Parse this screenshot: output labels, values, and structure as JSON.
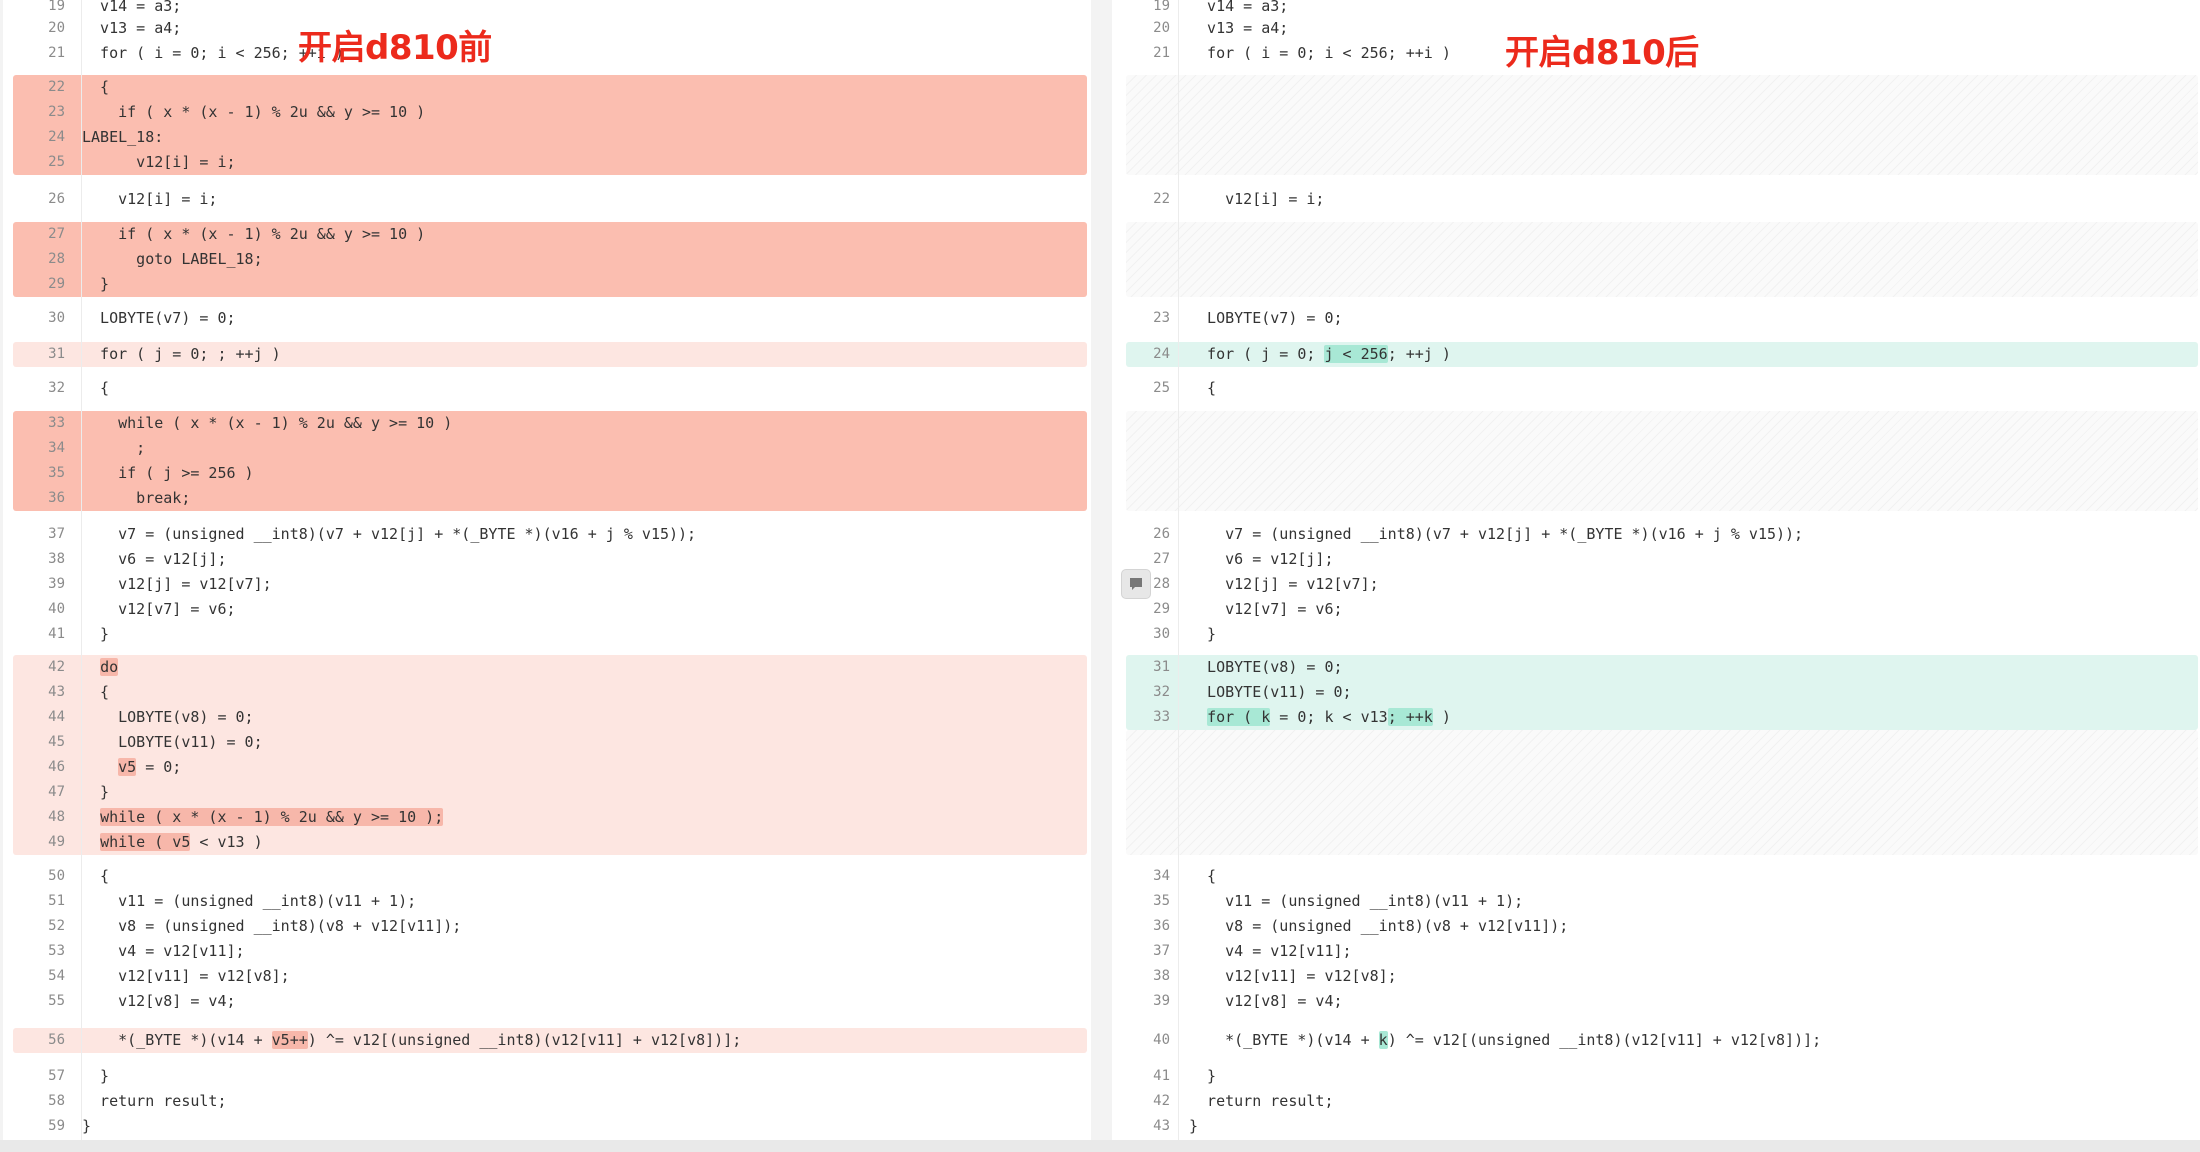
{
  "left_title": "开启d810前",
  "right_title": "开启d810后",
  "left": {
    "blocks": [
      {
        "kind": "del-strong",
        "from": 3,
        "to": 6
      },
      {
        "kind": "del-strong",
        "from": 8,
        "to": 10
      },
      {
        "kind": "del-light",
        "from": 13,
        "to": 13
      },
      {
        "kind": "del-strong",
        "from": 16,
        "to": 19
      },
      {
        "kind": "del-light",
        "from": 26,
        "to": 33
      },
      {
        "kind": "del-light",
        "from": 41,
        "to": 41
      }
    ],
    "lines": [
      {
        "row": 0,
        "n": "19",
        "t": "  v14 = a3;"
      },
      {
        "row": 1,
        "n": "20",
        "t": "  v13 = a4;"
      },
      {
        "row": 2,
        "n": "21",
        "t": "  for ( i = 0; i < 256; ++i )"
      },
      {
        "row": 3,
        "n": "22",
        "t": "  {"
      },
      {
        "row": 4,
        "n": "23",
        "t": "    if ( x * (x - 1) % 2u && y >= 10 )"
      },
      {
        "row": 5,
        "n": "24",
        "t": "LABEL_18:"
      },
      {
        "row": 6,
        "n": "25",
        "t": "      v12[i] = i;"
      },
      {
        "row": 7,
        "n": "26",
        "t": "    v12[i] = i;"
      },
      {
        "row": 8,
        "n": "27",
        "t": "    if ( x * (x - 1) % 2u && y >= 10 )"
      },
      {
        "row": 9,
        "n": "28",
        "t": "      goto LABEL_18;"
      },
      {
        "row": 10,
        "n": "29",
        "t": "  }"
      },
      {
        "row": 12,
        "n": "30",
        "t": "  LOBYTE(v7) = 0;"
      },
      {
        "row": 13,
        "n": "31",
        "t": "  for ( j = 0; ; ++j )"
      },
      {
        "row": 15,
        "n": "32",
        "t": "  {"
      },
      {
        "row": 16,
        "n": "33",
        "t": "    while ( x * (x - 1) % 2u && y >= 10 )"
      },
      {
        "row": 17,
        "n": "34",
        "t": "      ;"
      },
      {
        "row": 18,
        "n": "35",
        "t": "    if ( j >= 256 )"
      },
      {
        "row": 19,
        "n": "36",
        "t": "      break;"
      },
      {
        "row": 20,
        "n": "37",
        "t": "    v7 = (unsigned __int8)(v7 + v12[j] + *(_BYTE *)(v16 + j % v15));"
      },
      {
        "row": 21,
        "n": "38",
        "t": "    v6 = v12[j];"
      },
      {
        "row": 22,
        "n": "39",
        "t": "    v12[j] = v12[v7];"
      },
      {
        "row": 23,
        "n": "40",
        "t": "    v12[v7] = v6;"
      },
      {
        "row": 24,
        "n": "41",
        "t": "  }"
      },
      {
        "row": 26,
        "n": "42",
        "t": "  do"
      },
      {
        "row": 27,
        "n": "43",
        "t": "  {"
      },
      {
        "row": 28,
        "n": "44",
        "t": "    LOBYTE(v8) = 0;"
      },
      {
        "row": 29,
        "n": "45",
        "t": "    LOBYTE(v11) = 0;"
      },
      {
        "row": 30,
        "n": "46",
        "t": "    v5 = 0;"
      },
      {
        "row": 31,
        "n": "47",
        "t": "  }"
      },
      {
        "row": 32,
        "n": "48",
        "t": "  while ( x * (x - 1) % 2u && y >= 10 );"
      },
      {
        "row": 33,
        "n": "49",
        "t": "  while ( v5 < v13 )"
      },
      {
        "row": 35,
        "n": "50",
        "t": "  {"
      },
      {
        "row": 36,
        "n": "51",
        "t": "    v11 = (unsigned __int8)(v11 + 1);"
      },
      {
        "row": 37,
        "n": "52",
        "t": "    v8 = (unsigned __int8)(v8 + v12[v11]);"
      },
      {
        "row": 38,
        "n": "53",
        "t": "    v4 = v12[v11];"
      },
      {
        "row": 39,
        "n": "54",
        "t": "    v12[v11] = v12[v8];"
      },
      {
        "row": 40,
        "n": "55",
        "t": "    v12[v8] = v4;"
      },
      {
        "row": 41,
        "n": "56",
        "t": "    *(_BYTE *)(v14 + v5++) ^= v12[(unsigned __int8)(v12[v11] + v12[v8])];"
      },
      {
        "row": 43,
        "n": "57",
        "t": "  }"
      },
      {
        "row": 44,
        "n": "58",
        "t": "  return result;"
      },
      {
        "row": 45,
        "n": "59",
        "t": "}"
      }
    ]
  },
  "right": {
    "blocks": [
      {
        "kind": "pad",
        "from": 3,
        "to": 6
      },
      {
        "kind": "pad",
        "from": 8,
        "to": 10
      },
      {
        "kind": "add-light",
        "from": 13,
        "to": 13
      },
      {
        "kind": "pad",
        "from": 16,
        "to": 19
      },
      {
        "kind": "add-light",
        "from": 26,
        "to": 28
      },
      {
        "kind": "pad",
        "from": 29,
        "to": 33
      }
    ],
    "lines": [
      {
        "row": 0,
        "n": "19",
        "t": "  v14 = a3;"
      },
      {
        "row": 1,
        "n": "20",
        "t": "  v13 = a4;"
      },
      {
        "row": 2,
        "n": "21",
        "t": "  for ( i = 0; i < 256; ++i )"
      },
      {
        "row": 7,
        "n": "22",
        "t": "    v12[i] = i;"
      },
      {
        "row": 12,
        "n": "23",
        "t": "  LOBYTE(v7) = 0;"
      },
      {
        "row": 13,
        "n": "24",
        "t": "  for ( j = 0; j < 256; ++j )"
      },
      {
        "row": 15,
        "n": "25",
        "t": "  {"
      },
      {
        "row": 20,
        "n": "26",
        "t": "    v7 = (unsigned __int8)(v7 + v12[j] + *(_BYTE *)(v16 + j % v15));"
      },
      {
        "row": 21,
        "n": "27",
        "t": "    v6 = v12[j];"
      },
      {
        "row": 22,
        "n": "28",
        "t": "    v12[j] = v12[v7];"
      },
      {
        "row": 23,
        "n": "29",
        "t": "    v12[v7] = v6;"
      },
      {
        "row": 24,
        "n": "30",
        "t": "  }"
      },
      {
        "row": 26,
        "n": "31",
        "t": "  LOBYTE(v8) = 0;"
      },
      {
        "row": 27,
        "n": "32",
        "t": "  LOBYTE(v11) = 0;"
      },
      {
        "row": 28,
        "n": "33",
        "t": "  for ( k = 0; k < v13; ++k )"
      },
      {
        "row": 35,
        "n": "34",
        "t": "  {"
      },
      {
        "row": 36,
        "n": "35",
        "t": "    v11 = (unsigned __int8)(v11 + 1);"
      },
      {
        "row": 37,
        "n": "36",
        "t": "    v8 = (unsigned __int8)(v8 + v12[v11]);"
      },
      {
        "row": 38,
        "n": "37",
        "t": "    v4 = v12[v11];"
      },
      {
        "row": 39,
        "n": "38",
        "t": "    v12[v11] = v12[v8];"
      },
      {
        "row": 40,
        "n": "39",
        "t": "    v12[v8] = v4;"
      },
      {
        "row": 41,
        "n": "40",
        "t": "    *(_BYTE *)(v14 + k) ^= v12[(unsigned __int8)(v12[v11] + v12[v8])];"
      },
      {
        "row": 43,
        "n": "41",
        "t": "  }"
      },
      {
        "row": 44,
        "n": "42",
        "t": "  return result;"
      },
      {
        "row": 45,
        "n": "43",
        "t": "}"
      }
    ]
  },
  "highlights": {
    "left": [
      {
        "n": "42",
        "text": "do"
      },
      {
        "n": "46",
        "text": "v5"
      },
      {
        "n": "48",
        "text": "while ( x * (x - 1) % 2u && y >= 10 );"
      },
      {
        "n": "49",
        "text": "while ( v5"
      },
      {
        "n": "56",
        "text": "v5++"
      }
    ],
    "right": [
      {
        "n": "24",
        "text": "j < 256"
      },
      {
        "n": "33",
        "text": "for ( k"
      },
      {
        "n": "33",
        "text": "; ++k"
      },
      {
        "n": "40",
        "text": "k"
      }
    ]
  },
  "icons": {
    "comment": "comment-icon"
  },
  "colors": {
    "title": "#ec2a1c",
    "deleted_strong": "#fbbeb0",
    "deleted_light": "#fde6e1",
    "added_light": "#dff5ef",
    "highlight_deleted": "#f7b7aa",
    "highlight_added": "#a8e8d5"
  }
}
